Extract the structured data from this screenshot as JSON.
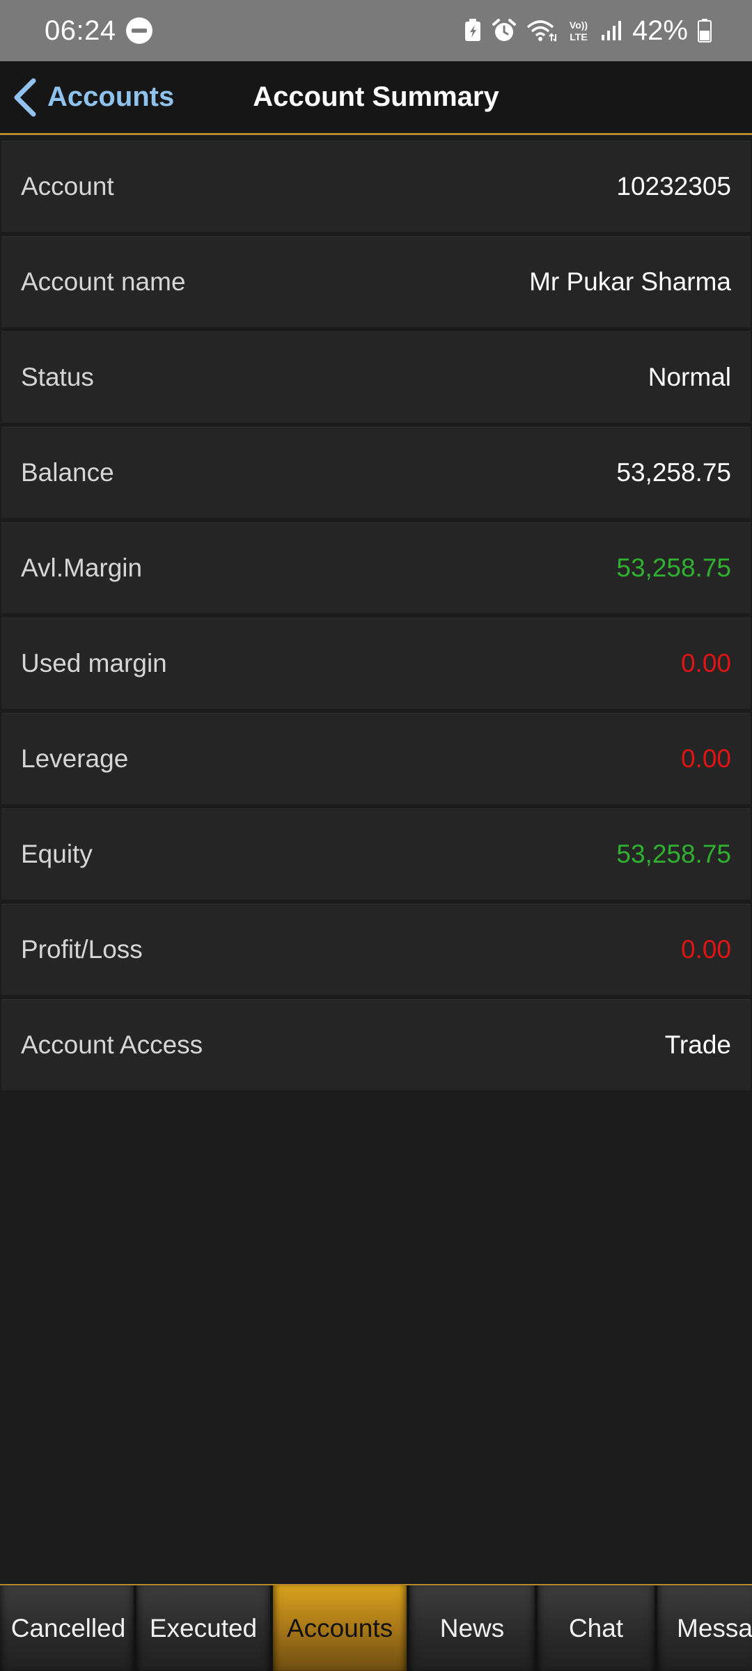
{
  "status_bar": {
    "time": "06:24",
    "battery_percent": "42%",
    "icons": [
      "do-not-disturb-icon",
      "battery-saver-icon",
      "alarm-icon",
      "wifi-icon",
      "volte-icon",
      "signal-icon",
      "battery-icon"
    ]
  },
  "nav": {
    "back_label": "Accounts",
    "title": "Account Summary"
  },
  "summary": [
    {
      "label": "Account",
      "value": "10232305",
      "color": "#ffffff"
    },
    {
      "label": "Account name",
      "value": "Mr Pukar Sharma",
      "color": "#ffffff"
    },
    {
      "label": "Status",
      "value": "Normal",
      "color": "#ffffff"
    },
    {
      "label": "Balance",
      "value": "53,258.75",
      "color": "#ffffff"
    },
    {
      "label": "Avl.Margin",
      "value": "53,258.75",
      "color": "#2fb12f"
    },
    {
      "label": "Used margin",
      "value": "0.00",
      "color": "#e01414"
    },
    {
      "label": "Leverage",
      "value": "0.00",
      "color": "#e01414"
    },
    {
      "label": "Equity",
      "value": "53,258.75",
      "color": "#2fb12f"
    },
    {
      "label": "Profit/Loss",
      "value": "0.00",
      "color": "#e01414"
    },
    {
      "label": "Account Access",
      "value": "Trade",
      "color": "#ffffff"
    }
  ],
  "tabs": [
    {
      "label": "Cancelled",
      "active": false
    },
    {
      "label": "Executed",
      "active": false
    },
    {
      "label": "Accounts",
      "active": true
    },
    {
      "label": "News",
      "active": false
    },
    {
      "label": "Chat",
      "active": false
    },
    {
      "label": "Messa",
      "active": false
    }
  ],
  "colors": {
    "accent": "#b58a2e",
    "link": "#8fc3ee",
    "positive": "#2fb12f",
    "negative": "#e01414"
  }
}
